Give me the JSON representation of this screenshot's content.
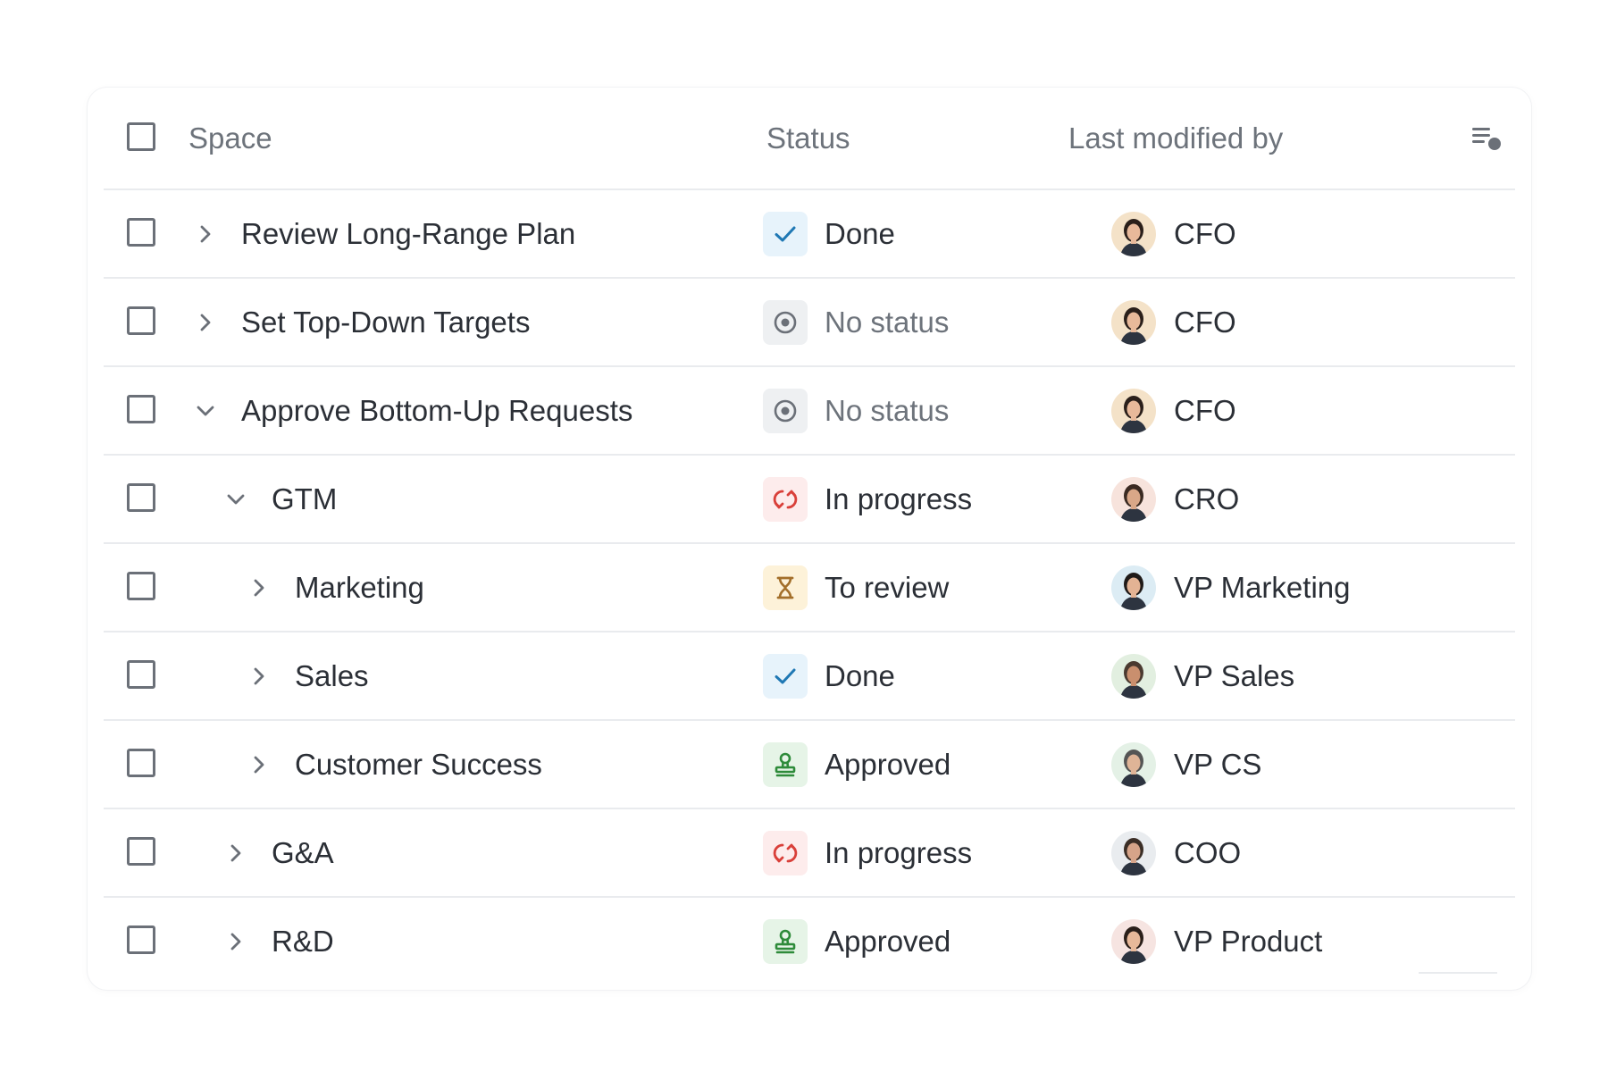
{
  "header": {
    "space": "Space",
    "status": "Status",
    "modified_by": "Last modified by",
    "columns_icon": "column-settings-icon"
  },
  "status_styles": {
    "Done": {
      "icon": "checkmark-icon",
      "bg": "#e7f3fb",
      "fg": "#1f78b4",
      "text": "#2b2f36"
    },
    "No status": {
      "icon": "target-circle-icon",
      "bg": "#eef0f2",
      "fg": "#6b7078",
      "text": "#6d737b"
    },
    "In progress": {
      "icon": "refresh-arrows-icon",
      "bg": "#fdecec",
      "fg": "#d9403a",
      "text": "#2b2f36"
    },
    "To review": {
      "icon": "hourglass-icon",
      "bg": "#fdf2d9",
      "fg": "#a36f2a",
      "text": "#2b2f36"
    },
    "Approved": {
      "icon": "stamp-icon",
      "bg": "#e6f4e7",
      "fg": "#2e8b3a",
      "text": "#2b2f36"
    }
  },
  "rows": [
    {
      "space": "Review Long-Range Plan",
      "level": 0,
      "expanded": false,
      "status": "Done",
      "person": "CFO",
      "avatar": "cfo-avatar",
      "avatar_bg": "#f4e2c8"
    },
    {
      "space": "Set Top-Down Targets",
      "level": 0,
      "expanded": false,
      "status": "No status",
      "person": "CFO",
      "avatar": "cfo-avatar",
      "avatar_bg": "#f4e2c8"
    },
    {
      "space": "Approve Bottom-Up Requests",
      "level": 0,
      "expanded": true,
      "status": "No status",
      "person": "CFO",
      "avatar": "cfo-avatar",
      "avatar_bg": "#f4e2c8"
    },
    {
      "space": "GTM",
      "level": 1,
      "expanded": true,
      "status": "In progress",
      "person": "CRO",
      "avatar": "cro-avatar",
      "avatar_bg": "#f7e3dc"
    },
    {
      "space": "Marketing",
      "level": 2,
      "expanded": false,
      "status": "To review",
      "person": "VP Marketing",
      "avatar": "vp-marketing-avatar",
      "avatar_bg": "#dcecf4"
    },
    {
      "space": "Sales",
      "level": 2,
      "expanded": false,
      "status": "Done",
      "person": "VP Sales",
      "avatar": "vp-sales-avatar",
      "avatar_bg": "#e2efe0"
    },
    {
      "space": "Customer Success",
      "level": 2,
      "expanded": false,
      "status": "Approved",
      "person": "VP CS",
      "avatar": "vp-cs-avatar",
      "avatar_bg": "#e4f1e6"
    },
    {
      "space": "G&A",
      "level": 1,
      "expanded": false,
      "status": "In progress",
      "person": "COO",
      "avatar": "coo-avatar",
      "avatar_bg": "#e9ecef"
    },
    {
      "space": "R&D",
      "level": 1,
      "expanded": false,
      "status": "Approved",
      "person": "VP Product",
      "avatar": "vp-product-avatar",
      "avatar_bg": "#f6e4e1"
    }
  ]
}
